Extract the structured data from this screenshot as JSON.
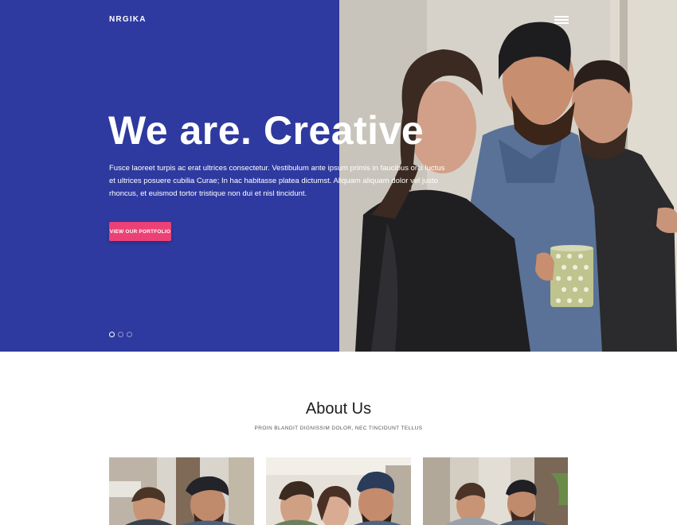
{
  "header": {
    "brand": "NRGIKA",
    "menu_icon": "hamburger-menu-icon"
  },
  "hero": {
    "headline": "We are. Creative",
    "intro": "Fusce laoreet turpis ac erat ultrices consectetur. Vestibulum ante ipsum primis in faucibus orci luctus et ultrices posuere cubilia Curae; In hac habitasse platea dictumst. Aliquam aliquam dolor vel justo rhoncus, et euismod tortor tristique non dui et nisl tincidunt.",
    "cta_label": "VIEW OUR PORTFOLIO",
    "slides_total": 3,
    "active_slide": 1
  },
  "about": {
    "title": "About Us",
    "subtitle": "PROIN BLANDIT DIGNISSIM DOLOR, NEC TINCIDUNT TELLUS"
  },
  "colors": {
    "hero_blue": "#2e3a9f",
    "cta_pink": "#ec4176",
    "text_dark": "#1c1c1c",
    "background": "#ffffff"
  }
}
